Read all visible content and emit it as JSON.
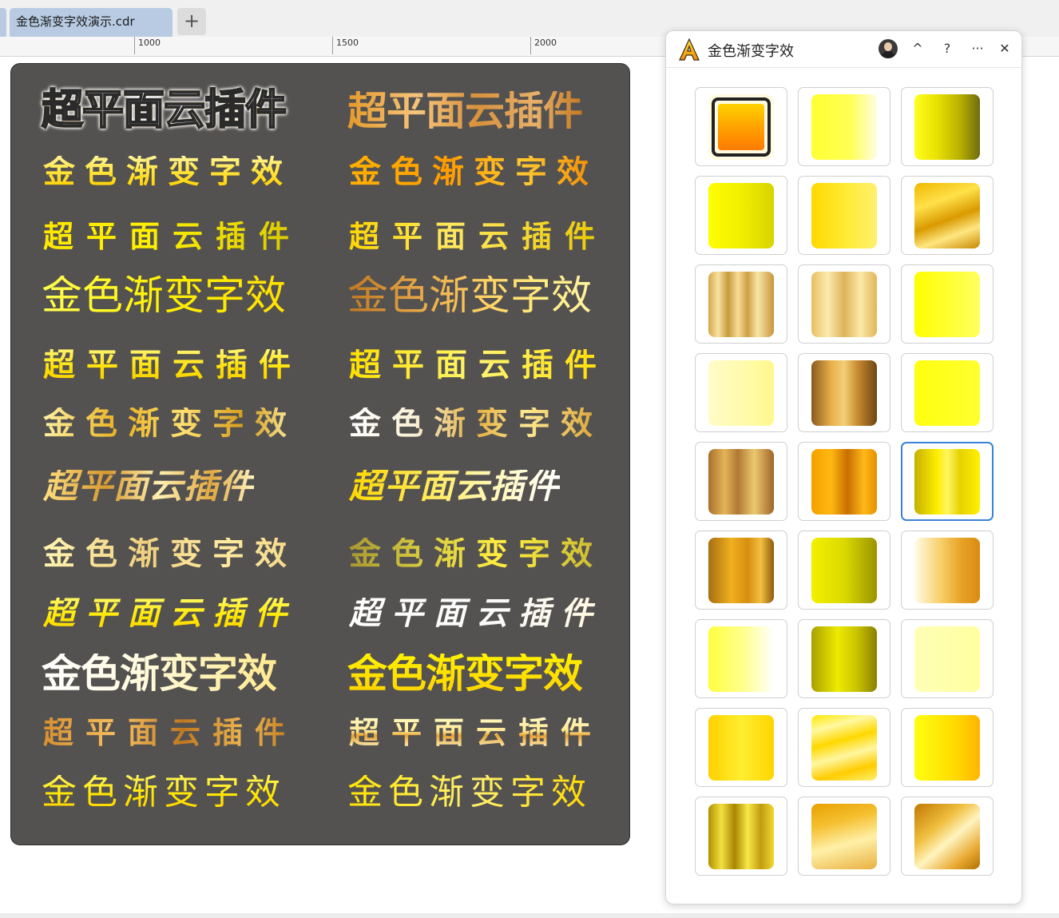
{
  "tabs": {
    "active_label": "金色渐变字效演示.cdr",
    "add_label": "+"
  },
  "ruler": {
    "labels": [
      "1000",
      "1500",
      "2000"
    ]
  },
  "canvas": {
    "samples": [
      {
        "text": "超平面云插件"
      },
      {
        "text": "超平面云插件"
      },
      {
        "text": "金色渐变字效"
      },
      {
        "text": "金色渐变字效"
      },
      {
        "text": "超平面云插件"
      },
      {
        "text": "超平面云插件"
      },
      {
        "text": "金色渐变字效"
      },
      {
        "text": "金色渐变字效"
      },
      {
        "text": "超平面云插件"
      },
      {
        "text": "超平面云插件"
      },
      {
        "text": "金色渐变字效"
      },
      {
        "text": "金色渐变字效"
      },
      {
        "text": "超平面云插件"
      },
      {
        "text": "超平面云插件"
      },
      {
        "text": "金色渐变字效"
      },
      {
        "text": "金色渐变字效"
      },
      {
        "text": "超平面云插件"
      },
      {
        "text": "超平面云插件"
      },
      {
        "text": "金色渐变字效"
      },
      {
        "text": "金色渐变字效"
      },
      {
        "text": "超平面云插件"
      },
      {
        "text": "超平面云插件"
      },
      {
        "text": "金色渐变字效"
      },
      {
        "text": "金色渐变字效"
      }
    ]
  },
  "panel": {
    "title": "金色渐变字效",
    "buttons": {
      "collapse": "^",
      "help": "?",
      "more": "···",
      "close": "✕"
    },
    "selected_swatch": 14,
    "swatches": [
      {
        "gradient": "frame"
      },
      {
        "gradient": "linear-gradient(90deg,#ffff33 0%,#ffff55 60%,#fffde0 100%)"
      },
      {
        "gradient": "linear-gradient(90deg,#ffff20 0%,#e8e000 35%,#b8b000 70%,#6e6a10 100%)"
      },
      {
        "gradient": "linear-gradient(90deg,#ffff00 0%,#f2ee00 50%,#d8d400 100%)"
      },
      {
        "gradient": "linear-gradient(90deg,#ffd800 0%,#ffea30 50%,#fff070 100%)"
      },
      {
        "gradient": "linear-gradient(160deg,#f0b800 0%,#ffe14a 30%,#d99a00 55%,#ffe680 75%,#c88800 100%)"
      },
      {
        "gradient": "linear-gradient(90deg,#d4a84c 0%,#f7e2a2 15%,#c79a3e 30%,#f5dd94 45%,#cf9e45 60%,#f8e6a8 75%,#c9953a 100%)"
      },
      {
        "gradient": "linear-gradient(90deg,#e6c060 0%,#fbeab0 25%,#deb358 50%,#fce9a8 75%,#e0b658 100%)"
      },
      {
        "gradient": "linear-gradient(90deg,#ffff00 0%,#ffff30 50%,#ffff60 100%)"
      },
      {
        "gradient": "linear-gradient(90deg,#fffcc8 0%,#fffaa8 60%,#fff88c 100%)"
      },
      {
        "gradient": "linear-gradient(90deg,#8a5a1e 0%,#e8b04a 30%,#f3cf78 50%,#c98c30 70%,#6f4512 100%)"
      },
      {
        "gradient": "linear-gradient(90deg,#ffff10 0%,#ffff30 100%)"
      },
      {
        "gradient": "linear-gradient(90deg,#a8702c 0%,#e4b458 25%,#b07834 45%,#edc870 70%,#9e6528 100%)"
      },
      {
        "gradient": "linear-gradient(90deg,#f5a000 0%,#ffb810 30%,#c86e00 55%,#ffb818 80%,#e69000 100%)"
      },
      {
        "gradient": "linear-gradient(90deg,#c4b000 0%,#ffee00 35%,#fff560 50%,#e6d200 70%,#fff000 100%)"
      },
      {
        "gradient": "linear-gradient(90deg,#a66e10 0%,#f0b020 35%,#d68e10 60%,#f3c040 80%,#8e5a0c 100%)"
      },
      {
        "gradient": "linear-gradient(90deg,#f4f000 0%,#dada00 50%,#9a9400 100%)"
      },
      {
        "gradient": "linear-gradient(90deg,#fffce8 0%,#f7cf6a 40%,#e8a428 70%,#d88c10 100%)"
      },
      {
        "gradient": "linear-gradient(90deg,#ffff40 0%,#ffff90 55%,#ffffff 100%)"
      },
      {
        "gradient": "linear-gradient(90deg,#a8a000 0%,#eeea00 40%,#c8c200 70%,#888000 100%)"
      },
      {
        "gradient": "linear-gradient(90deg,#ffffb8 0%,#ffffa0 100%)"
      },
      {
        "gradient": "linear-gradient(90deg,#ffd000 0%,#ffee30 50%,#ffd400 100%)"
      },
      {
        "gradient": "linear-gradient(165deg,#ffe800 0%,#fff8a0 20%,#ffd800 40%,#fff6a0 60%,#ffcc00 80%,#fff070 100%)"
      },
      {
        "gradient": "linear-gradient(90deg,#ffff10 0%,#ffdc00 60%,#ffb400 100%)"
      },
      {
        "gradient": "linear-gradient(90deg,#b09000 0%,#f4e040 20%,#a88600 40%,#f8e848 60%,#c09c10 80%,#f0d830 100%)"
      },
      {
        "gradient": "linear-gradient(165deg,#e8a000 0%,#f5c030 30%,#fff0a8 60%,#e8b040 100%)"
      },
      {
        "gradient": "linear-gradient(140deg,#c07800 0%,#f0c040 35%,#fff4c0 55%,#e8a830 80%,#b07000 100%)"
      }
    ]
  }
}
